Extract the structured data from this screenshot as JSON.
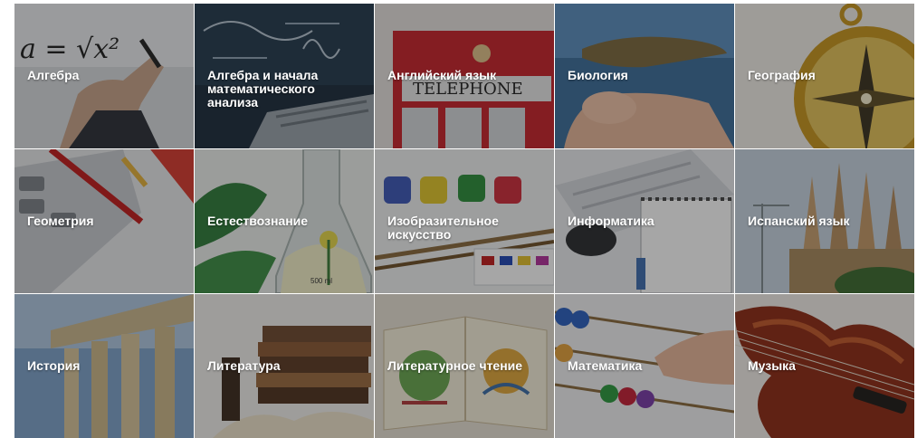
{
  "subjects": [
    {
      "label": "Алгебра",
      "icon": "algebra-formula-icon"
    },
    {
      "label": "Алгебра и начала математического анализа",
      "icon": "calculus-formula-icon"
    },
    {
      "label": "Английский язык",
      "icon": "telephone-booth-icon"
    },
    {
      "label": "Биология",
      "icon": "lizard-icon"
    },
    {
      "label": "География",
      "icon": "compass-icon"
    },
    {
      "label": "Геометрия",
      "icon": "ruler-calculator-icon"
    },
    {
      "label": "Естествознание",
      "icon": "flask-plant-icon"
    },
    {
      "label": "Изобразительное искусство",
      "icon": "paints-brushes-icon"
    },
    {
      "label": "Информатика",
      "icon": "keyboard-mouse-icon"
    },
    {
      "label": "Испанский язык",
      "icon": "sagrada-familia-icon"
    },
    {
      "label": "История",
      "icon": "greek-columns-icon"
    },
    {
      "label": "Литература",
      "icon": "books-stack-icon"
    },
    {
      "label": "Литературное чтение",
      "icon": "storybook-icon"
    },
    {
      "label": "Математика",
      "icon": "abacus-icon"
    },
    {
      "label": "Музыка",
      "icon": "violin-icon"
    }
  ],
  "image_text": {
    "algebra_formula": "a = √x²",
    "telephone_sign": "TELEPHONE",
    "flask_volume": "500 ml"
  },
  "colors": {
    "label_text": "#ffffff",
    "overlay": "rgba(20,20,20,0.38)"
  }
}
